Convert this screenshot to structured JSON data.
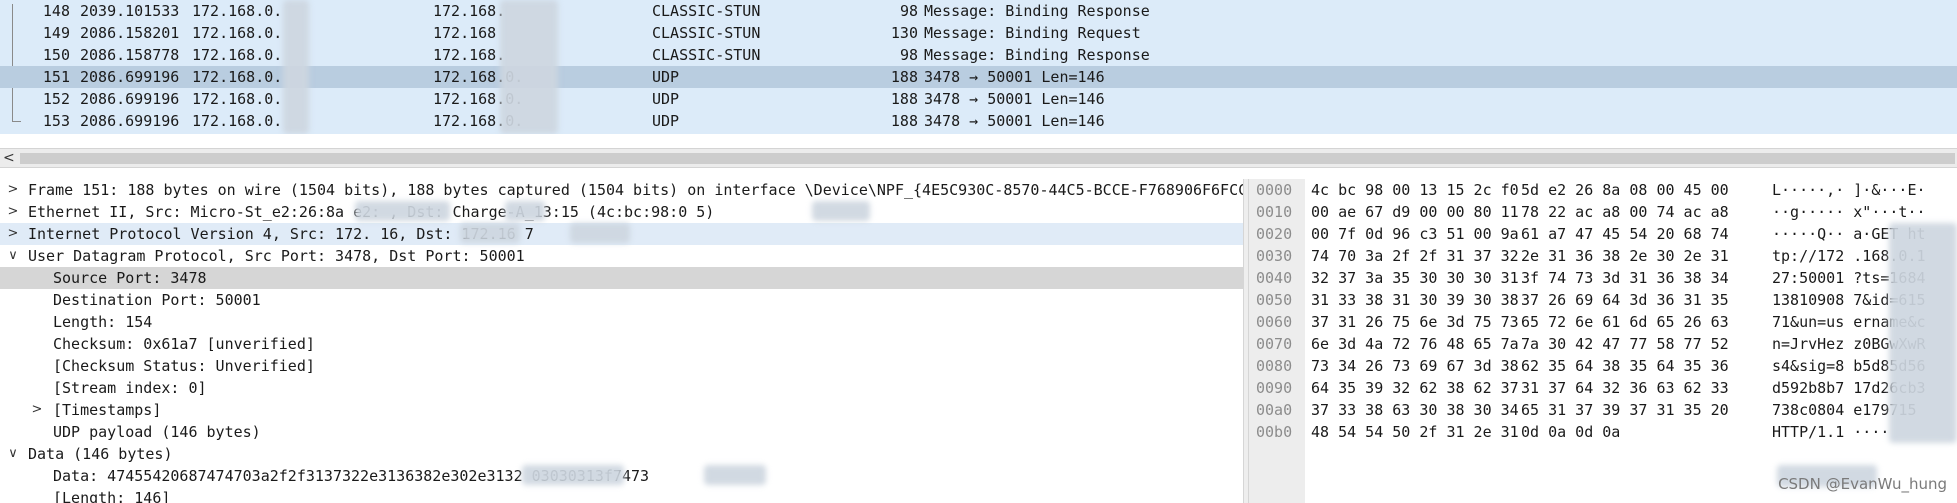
{
  "packets": [
    {
      "no": "148",
      "time": "2039.101533",
      "src": "172.168.0.",
      "dst": "172.168.",
      "proto": "CLASSIC-STUN",
      "len": "98",
      "info": "Message: Binding Response"
    },
    {
      "no": "149",
      "time": "2086.158201",
      "src": "172.168.0.",
      "dst": "172.168",
      "proto": "CLASSIC-STUN",
      "len": "130",
      "info": "Message: Binding Request"
    },
    {
      "no": "150",
      "time": "2086.158778",
      "src": "172.168.0.",
      "dst": "172.168.",
      "proto": "CLASSIC-STUN",
      "len": "98",
      "info": "Message: Binding Response"
    },
    {
      "no": "151",
      "time": "2086.699196",
      "src": "172.168.0.",
      "dst": "172.168.0.",
      "proto": "UDP",
      "len": "188",
      "info": "3478 → 50001 Len=146"
    },
    {
      "no": "152",
      "time": "2086.699196",
      "src": "172.168.0.",
      "dst": "172.168.0.",
      "proto": "UDP",
      "len": "188",
      "info": "3478 → 50001 Len=146"
    },
    {
      "no": "153",
      "time": "2086.699196",
      "src": "172.168.0.",
      "dst": "172.168.0.",
      "proto": "UDP",
      "len": "188",
      "info": "3478 → 50001 Len=146"
    }
  ],
  "scrollbar": {
    "left_arrow": "<"
  },
  "details": [
    {
      "toggle": ">",
      "text": "Frame 151: 188 bytes on wire (1504 bits), 188 bytes captured (1504 bits) on interface \\Device\\NPF_{4E5C930C-8570-44C5-BCCE-F768906F6FCC}"
    },
    {
      "toggle": ">",
      "text": "Ethernet II, Src: Micro-St_e2:26:8a                 e2:          , Dst: Charge-A_13:15 (4c:bc:98:0        5)"
    },
    {
      "toggle": ">",
      "text": "Internet Protocol Version 4, Src: 172.          16, Dst: 172.16         7"
    },
    {
      "toggle": "∨",
      "text": "User Datagram Protocol, Src Port: 3478, Dst Port: 50001"
    },
    {
      "toggle": "",
      "text": "Source Port: 3478"
    },
    {
      "toggle": "",
      "text": "Destination Port: 50001"
    },
    {
      "toggle": "",
      "text": "Length: 154"
    },
    {
      "toggle": "",
      "text": "Checksum: 0x61a7 [unverified]"
    },
    {
      "toggle": "",
      "text": "[Checksum Status: Unverified]"
    },
    {
      "toggle": "",
      "text": "[Stream index: 0]"
    },
    {
      "toggle": ">",
      "text": "[Timestamps]"
    },
    {
      "toggle": "",
      "text": "UDP payload (146 bytes)"
    },
    {
      "toggle": "∨",
      "text": "Data (146 bytes)"
    },
    {
      "toggle": "",
      "text": "Data: 47455420687474703a2f2f3137322e3136382e302e3132              03030313f7473"
    },
    {
      "toggle": "",
      "text": "[Length: 146]"
    }
  ],
  "hex": [
    {
      "offset": "0000",
      "hex1": "4c bc 98 00 13 15 2c f0",
      "hex2": "5d e2 26 8a 08 00 45 00",
      "ascii": "L·····,·  ]·&···E·"
    },
    {
      "offset": "0010",
      "hex1": "00 ae 67 d9 00 00 80 11",
      "hex2": "78 22 ac a8 00 74 ac a8",
      "ascii": "··g·····  x\"···t··"
    },
    {
      "offset": "0020",
      "hex1": "00 7f 0d 96 c3 51 00 9a",
      "hex2": "61 a7 47 45 54 20 68 74",
      "ascii": "·····Q··  a·GET ht"
    },
    {
      "offset": "0030",
      "hex1": "74 70 3a 2f 2f 31 37 32",
      "hex2": "2e 31 36 38 2e 30 2e 31",
      "ascii": "tp://172  .168.0.1"
    },
    {
      "offset": "0040",
      "hex1": "32 37 3a 35 30 30 30 31",
      "hex2": "3f 74 73 3d 31 36 38 34",
      "ascii": "27:50001  ?ts=1684"
    },
    {
      "offset": "0050",
      "hex1": "31 33 38 31 30 39 30 38",
      "hex2": "37 26 69 64 3d 36 31 35",
      "ascii": "13810908  7&id=615"
    },
    {
      "offset": "0060",
      "hex1": "37 31 26 75 6e 3d 75 73",
      "hex2": "65 72 6e 61 6d 65 26 63",
      "ascii": "71&un=us  ername&c"
    },
    {
      "offset": "0070",
      "hex1": "6e 3d 4a 72 76 48 65 7a",
      "hex2": "7a 30 42 47 77 58 77 52",
      "ascii": "n=JrvHez  z0BGwXwR"
    },
    {
      "offset": "0080",
      "hex1": "73 34 26 73 69 67 3d 38",
      "hex2": "62 35 64 38 35 64 35 36",
      "ascii": "s4&sig=8  b5d85d56"
    },
    {
      "offset": "0090",
      "hex1": "64 35 39 32 62 38 62 37",
      "hex2": "31 37 64 32 36 63 62 33",
      "ascii": "d592b8b7  17d26cb3"
    },
    {
      "offset": "00a0",
      "hex1": "37 33 38 63 30 38 30 34",
      "hex2": "65 31 37 39 37 31 35 20",
      "ascii": "738c0804  e179715 "
    },
    {
      "offset": "00b0",
      "hex1": "48 54 54 50 2f 31 2e 31",
      "hex2": "0d 0a 0d 0a",
      "ascii": "HTTP/1.1  ····"
    }
  ],
  "watermark": "CSDN @EvanWu_hung",
  "colors": {
    "list_bg": "#dcebf9",
    "selected_row": "#b9cde0",
    "detail_highlight": "#e0ebf7",
    "detail_selected": "#d6d6d6"
  }
}
